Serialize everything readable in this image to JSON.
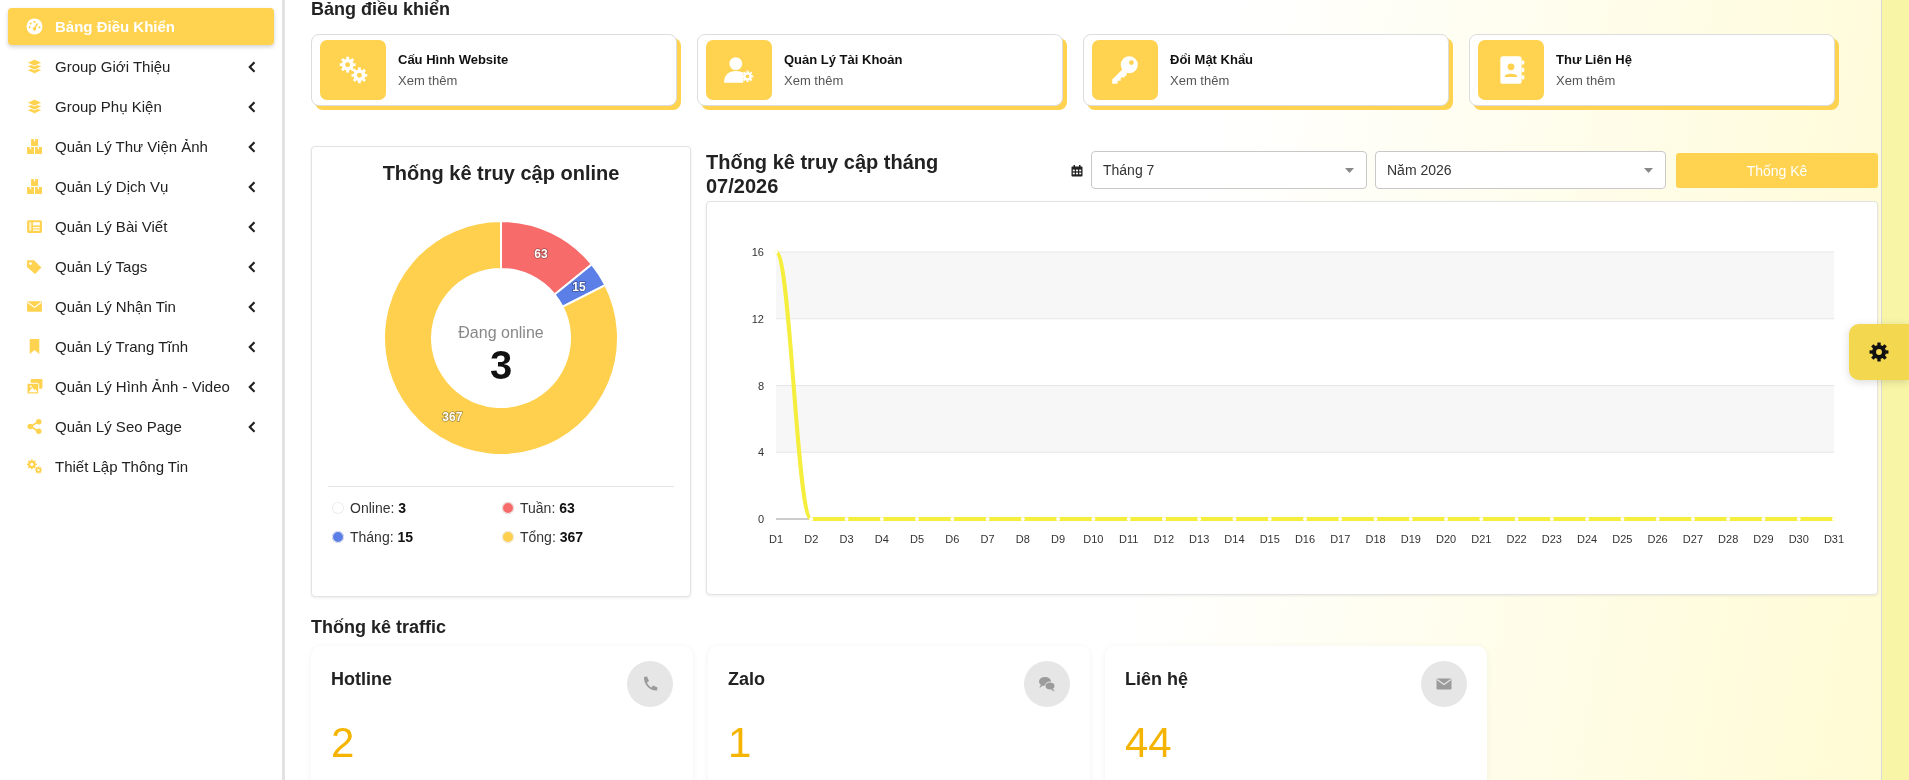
{
  "sidebar": {
    "items": [
      {
        "label": "Bảng Điều Khiển",
        "selected": true,
        "has_submenu": false
      },
      {
        "label": "Group Giới Thiệu",
        "selected": false,
        "has_submenu": true
      },
      {
        "label": "Group Phụ Kiện",
        "selected": false,
        "has_submenu": true
      },
      {
        "label": "Quản Lý Thư Viện Ảnh",
        "selected": false,
        "has_submenu": true
      },
      {
        "label": "Quản Lý Dịch Vụ",
        "selected": false,
        "has_submenu": true
      },
      {
        "label": "Quản Lý Bài Viết",
        "selected": false,
        "has_submenu": true
      },
      {
        "label": "Quản Lý Tags",
        "selected": false,
        "has_submenu": true
      },
      {
        "label": "Quản Lý Nhận Tin",
        "selected": false,
        "has_submenu": true
      },
      {
        "label": "Quản Lý Trang Tĩnh",
        "selected": false,
        "has_submenu": true
      },
      {
        "label": "Quản Lý Hình Ảnh - Video",
        "selected": false,
        "has_submenu": true
      },
      {
        "label": "Quản Lý Seo Page",
        "selected": false,
        "has_submenu": true
      },
      {
        "label": "Thiết Lập Thông Tin",
        "selected": false,
        "has_submenu": false
      }
    ]
  },
  "page_title": "Bảng điều khiển",
  "shortcuts": [
    {
      "title": "Cấu Hình Website",
      "link": "Xem thêm"
    },
    {
      "title": "Quản Lý Tài Khoản",
      "link": "Xem thêm"
    },
    {
      "title": "Đổi Mật Khẩu",
      "link": "Xem thêm"
    },
    {
      "title": "Thư Liên Hệ",
      "link": "Xem thêm"
    }
  ],
  "online_stats": {
    "title": "Thống kê truy cập online",
    "center_label": "Đang online",
    "center_value": "3",
    "chart_data": {
      "type": "donut",
      "values": [
        63,
        15,
        367
      ],
      "data_labels": true
    },
    "legend": [
      {
        "label": "Online:",
        "value": "3",
        "color": "#ffffff"
      },
      {
        "label": "Tuần:",
        "value": "63",
        "color": "#f76b6b"
      },
      {
        "label": "Tháng:",
        "value": "15",
        "color": "#5b7fe6"
      },
      {
        "label": "Tổng:",
        "value": "367",
        "color": "#ffd04d"
      }
    ]
  },
  "monthly_stats": {
    "title": "Thống kê truy cập tháng 07/2026",
    "month_select": {
      "value": "Tháng 7"
    },
    "year_select": {
      "value": "Năm 2026"
    },
    "submit_button": "Thống Kê",
    "chart_data": {
      "type": "line",
      "categories": [
        "D1",
        "D2",
        "D3",
        "D4",
        "D5",
        "D6",
        "D7",
        "D8",
        "D9",
        "D10",
        "D11",
        "D12",
        "D13",
        "D14",
        "D15",
        "D16",
        "D17",
        "D18",
        "D19",
        "D20",
        "D21",
        "D22",
        "D23",
        "D24",
        "D25",
        "D26",
        "D27",
        "D28",
        "D29",
        "D30",
        "D31"
      ],
      "series": [
        {
          "color": "#f5ee3c",
          "values": [
            16,
            0,
            0,
            0,
            0,
            0,
            0,
            0,
            0,
            0,
            0,
            0,
            0,
            0,
            0,
            0,
            0,
            0,
            0,
            0,
            0,
            0,
            0,
            0,
            0,
            0,
            0,
            0,
            0,
            0,
            0
          ]
        }
      ],
      "ylim": [
        0,
        16
      ],
      "yticks": [
        0,
        4,
        8,
        12,
        16
      ],
      "grid": true
    }
  },
  "traffic": {
    "title": "Thống kê traffic",
    "cards": [
      {
        "label": "Hotline",
        "value": "2"
      },
      {
        "label": "Zalo",
        "value": "1"
      },
      {
        "label": "Liên hệ",
        "value": "44"
      }
    ]
  }
}
